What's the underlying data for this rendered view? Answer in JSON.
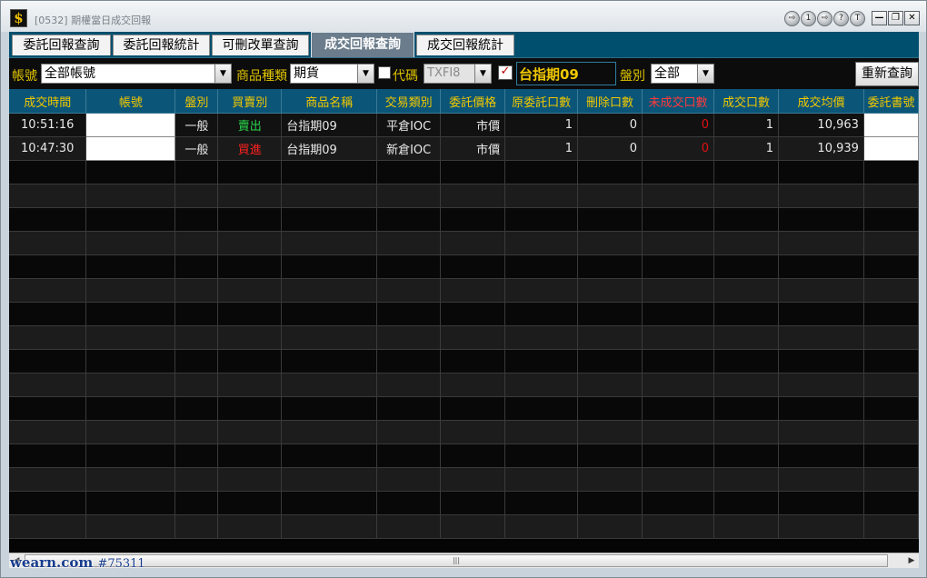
{
  "window": {
    "title": "[0532] 期權當日成交回報",
    "app_icon_glyph": "$",
    "title_buttons": [
      "⇨",
      "1",
      "⇨",
      "?",
      "T"
    ],
    "win_buttons": {
      "minimize": "—",
      "maximize": "❐",
      "close": "✕"
    }
  },
  "tabs": [
    {
      "label": "委託回報查詢",
      "active": false
    },
    {
      "label": "委託回報統計",
      "active": false
    },
    {
      "label": "可刪改單查詢",
      "active": false
    },
    {
      "label": "成交回報查詢",
      "active": true
    },
    {
      "label": "成交回報統計",
      "active": false
    }
  ],
  "filters": {
    "account_label": "帳號",
    "account_value": "全部帳號",
    "product_type_label": "商品種類",
    "product_type_value": "期貨",
    "code_label": "代碼",
    "code_value": "TXFI8",
    "code_checked": false,
    "symbol_checked": true,
    "symbol_display": "台指期09",
    "session_label": "盤別",
    "session_value": "全部",
    "requery_button": "重新查詢"
  },
  "grid": {
    "columns": [
      "成交時間",
      "帳號",
      "盤別",
      "買賣別",
      "商品名稱",
      "交易類別",
      "委託價格",
      "原委託口數",
      "刪除口數",
      "未成交口數",
      "成交口數",
      "成交均價",
      "委託書號"
    ],
    "rows": [
      {
        "time": "10:51:16",
        "account": "",
        "session": "一般",
        "side": "賣出",
        "side_type": "sell",
        "product": "台指期09",
        "trade_type": "平倉IOC",
        "price": "市價",
        "orig_qty": "1",
        "del_qty": "0",
        "unfilled_qty": "0",
        "filled_qty": "1",
        "avg_price": "10,963",
        "order_no": ""
      },
      {
        "time": "10:47:30",
        "account": "",
        "session": "一般",
        "side": "買進",
        "side_type": "buy",
        "product": "台指期09",
        "trade_type": "新倉IOC",
        "price": "市價",
        "orig_qty": "1",
        "del_qty": "0",
        "unfilled_qty": "0",
        "filled_qty": "1",
        "avg_price": "10,939",
        "order_no": ""
      }
    ]
  },
  "scrollbar": {
    "grip": "|||"
  },
  "watermark": {
    "site": "wearn.com",
    "id": "#75311"
  },
  "colors": {
    "header_bg": "#0b5578",
    "header_text": "#f0c800",
    "tab_strip": "#004f6e",
    "sell": "#29d34a",
    "buy": "#ff2020"
  }
}
